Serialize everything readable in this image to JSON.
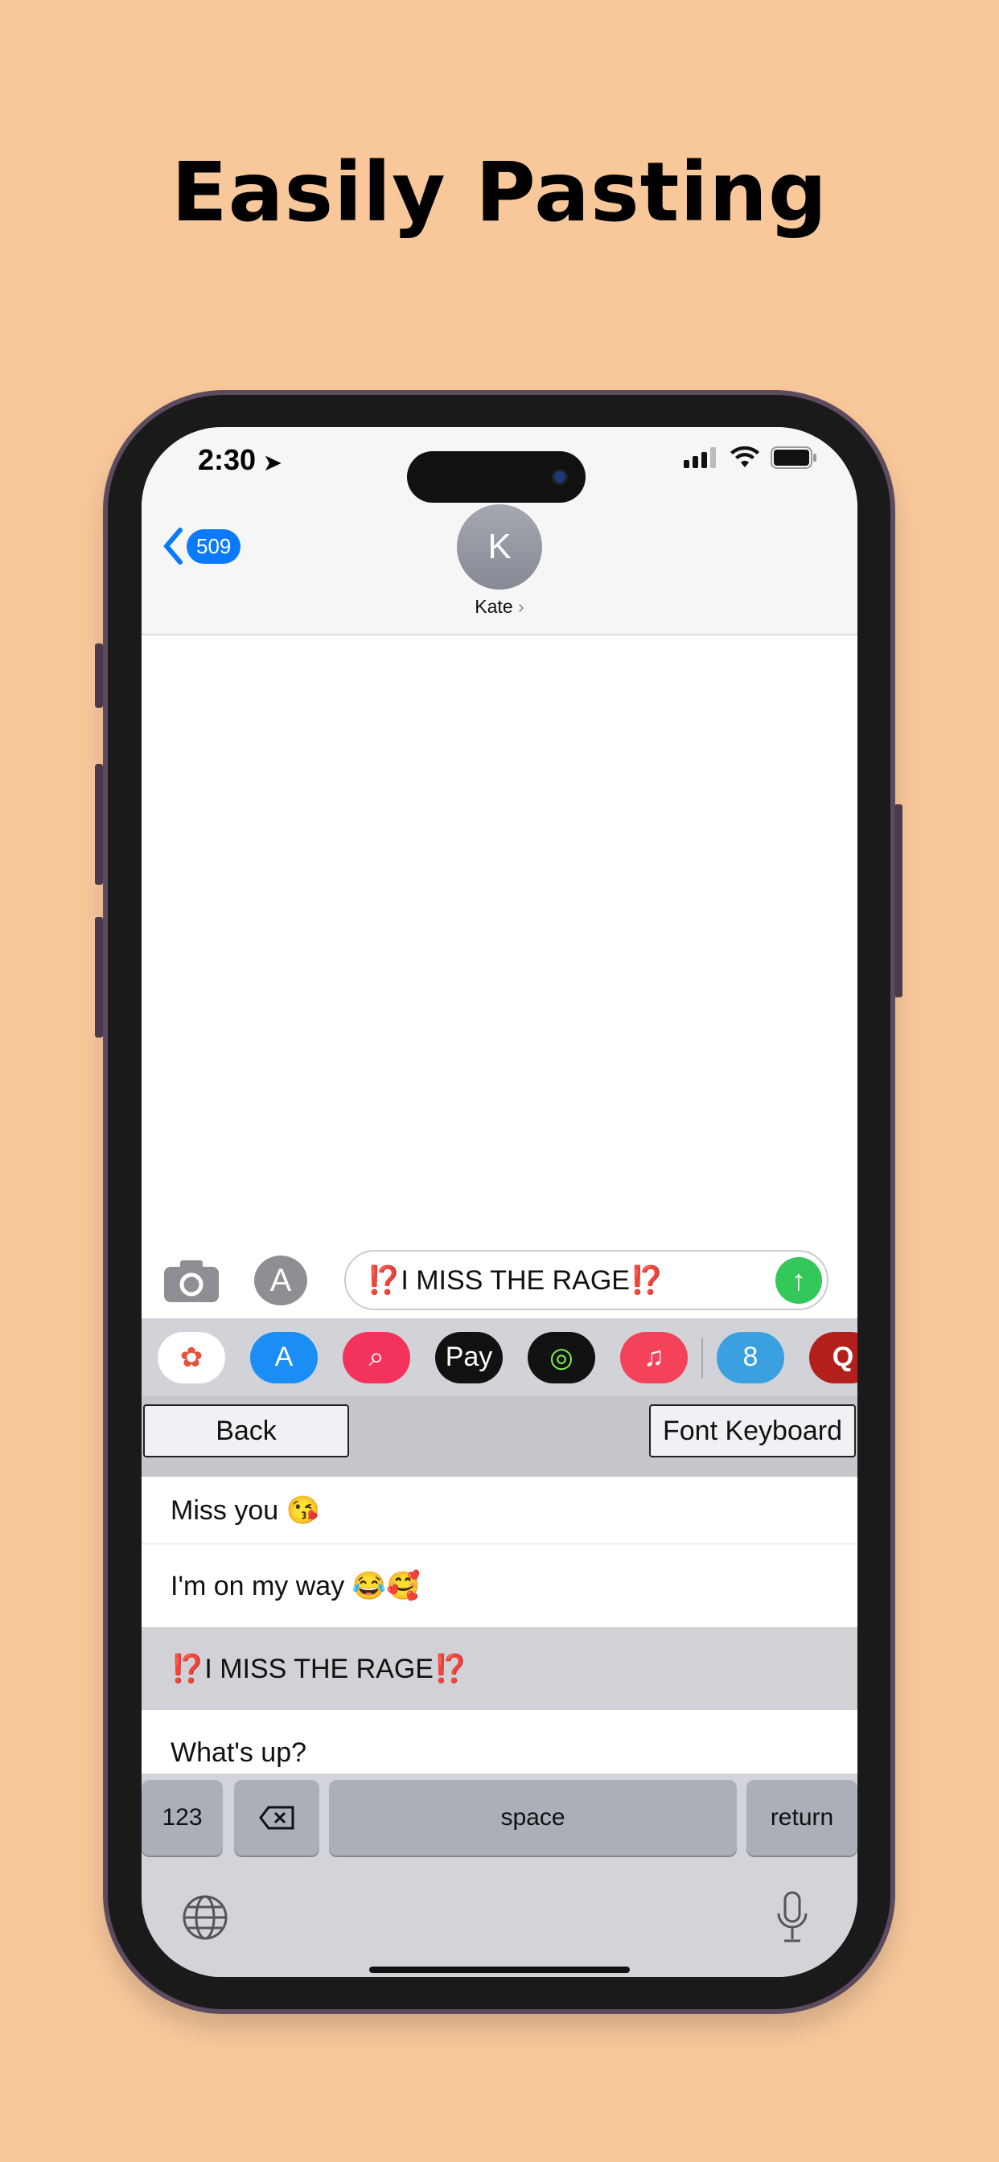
{
  "headline": "Easily Pasting",
  "status_bar": {
    "time": "2:30"
  },
  "nav": {
    "back_count": "509",
    "avatar_initial": "K",
    "contact_name": "Kate"
  },
  "composer": {
    "text": "⁉️I MISS THE RAGE⁉️"
  },
  "app_strip": [
    {
      "icon": "photos-icon",
      "bg": "#ffffff"
    },
    {
      "icon": "app-store-icon",
      "bg": "#1a8ef5"
    },
    {
      "icon": "image-search-icon",
      "bg": "#f4335d"
    },
    {
      "icon": "apple-pay-icon",
      "bg": "#111111",
      "label": "Pay"
    },
    {
      "icon": "activity-icon",
      "bg": "#111111"
    },
    {
      "icon": "music-icon",
      "bg": "#f5425b"
    },
    {
      "icon": "8-ball-pool-icon",
      "bg": "#3aa0e0"
    },
    {
      "icon": "quiz-icon",
      "bg": "#b3201c",
      "label": "Q"
    }
  ],
  "keyboard_toolbar": {
    "back": "Back",
    "font_keyboard": "Font Keyboard"
  },
  "phrases": [
    "Miss you 😘",
    "I'm on my way 😂🥰",
    "⁉️I MISS THE RAGE⁉️",
    "What's up?"
  ],
  "selected_phrase_index": 2,
  "keys": {
    "numbers": "123",
    "space": "space",
    "return": "return"
  }
}
